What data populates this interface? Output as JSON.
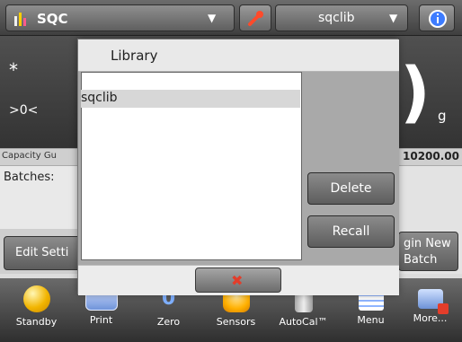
{
  "header": {
    "app_name": "SQC",
    "library_selected": "sqclib",
    "menu_caret": "▼"
  },
  "display": {
    "asterisk": "*",
    "zero_indicator": ">0<",
    "unit": "g",
    "large_digit_fragment": ")"
  },
  "info": {
    "capacity_label_partial": "Capacity Gu",
    "capacity_value": "10200.00",
    "batches_label": "Batches:",
    "edit_settings_partial": "Edit Setti",
    "begin_batch_line1": "gin New",
    "begin_batch_line2": "Batch"
  },
  "dialog": {
    "title": "Library",
    "items": [
      "sqclib"
    ],
    "delete_label": "Delete",
    "recall_label": "Recall",
    "cancel_glyph": "✖"
  },
  "bottom_nav": [
    {
      "label": "Standby",
      "icon": "standby-icon"
    },
    {
      "label": "Print",
      "icon": "printer-icon"
    },
    {
      "label": "Zero",
      "icon": "zero-icon"
    },
    {
      "label": "Sensors",
      "icon": "sensors-icon"
    },
    {
      "label": "AutoCal™",
      "icon": "autocal-icon"
    },
    {
      "label": "Menu",
      "icon": "menu-icon"
    },
    {
      "label": "More...",
      "icon": "more-icon"
    }
  ],
  "colors": {
    "accent_red": "#e33d2a",
    "accent_blue": "#3d7cff",
    "standby_orange": "#f2b500"
  }
}
